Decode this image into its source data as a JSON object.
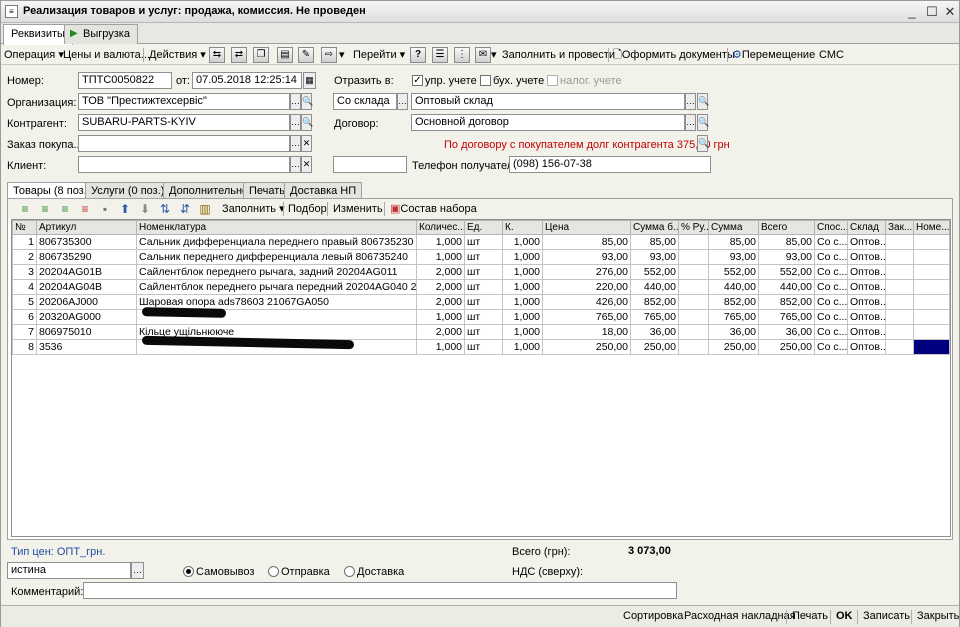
{
  "window": {
    "title": "Реализация товаров и услуг: продажа, комиссия. Не проведен"
  },
  "page_tabs": [
    {
      "label": "Реквизиты"
    },
    {
      "label": "Выгрузка"
    }
  ],
  "toolbar": {
    "operation": "Операция",
    "prices": "Цены и валюта...",
    "actions": "Действия",
    "goto": "Перейти",
    "help": "?",
    "fill_post": "Заполнить и провести",
    "make_docs": "Оформить документы",
    "move": "Перемещение",
    "sms": "СМС"
  },
  "form": {
    "number_label": "Номер:",
    "number": "ТПТС0050822",
    "date_label": "от:",
    "date": "07.05.2018 12:25:14",
    "reflect_label": "Отразить в:",
    "mgmt_label": "упр. учете",
    "acc_label": "бух. учете",
    "tax_label": "налог. учете",
    "org_label": "Организация:",
    "org": "ТОВ \"Престижтехсервіс\"",
    "warehouse_kind": "Со склада",
    "warehouse": "Оптовый склад",
    "counterparty_label": "Контрагент:",
    "counterparty": "SUBARU-PARTS-KYIV",
    "contract_label": "Договор:",
    "contract": "Основной договор",
    "order_label": "Заказ покупа...",
    "order": "",
    "debt_note": "По договору с покупателем долг контрагента 375,00 грн",
    "client_label": "Клиент:",
    "client": "",
    "extra_field": "",
    "phone_label": "Телефон получателя:",
    "phone": "(098) 156-07-38"
  },
  "inner_tabs": [
    {
      "label": "Товары (8 поз.)"
    },
    {
      "label": "Услуги (0 поз.)"
    },
    {
      "label": "Дополнительно"
    },
    {
      "label": "Печать"
    },
    {
      "label": "Доставка НП"
    }
  ],
  "table_toolbar": {
    "fill": "Заполнить",
    "pick": "Подбор",
    "change": "Изменить",
    "kit": "Состав набора"
  },
  "table": {
    "columns": [
      "№",
      "Артикул",
      "Номенклатура",
      "Количес...",
      "Ед.",
      "К.",
      "Цена",
      "Сумма б...",
      "% Ру...",
      "Сумма",
      "Всего",
      "Спос...",
      "Склад",
      "Зак...",
      "Номе..."
    ],
    "rows": [
      [
        "1",
        "806735300",
        "Сальник дифференциала переднего правый 806735230",
        "1,000",
        "шт",
        "1,000",
        "85,00",
        "85,00",
        "",
        "85,00",
        "85,00",
        "Со с...",
        "Оптов...",
        "",
        ""
      ],
      [
        "2",
        "806735290",
        "Сальник переднего дифференциала левый 806735240",
        "1,000",
        "шт",
        "1,000",
        "93,00",
        "93,00",
        "",
        "93,00",
        "93,00",
        "Со с...",
        "Оптов...",
        "",
        ""
      ],
      [
        "3",
        "20204AG01B",
        "Сайлентблок переднего рычага, задний 20204AG011",
        "2,000",
        "шт",
        "1,000",
        "276,00",
        "552,00",
        "",
        "552,00",
        "552,00",
        "Со с...",
        "Оптов...",
        "",
        ""
      ],
      [
        "4",
        "20204AG04B",
        "Сайлентблок  переднего рычага передний 20204AG040 202...",
        "2,000",
        "шт",
        "1,000",
        "220,00",
        "440,00",
        "",
        "440,00",
        "440,00",
        "Со с...",
        "Оптов...",
        "",
        ""
      ],
      [
        "5",
        "20206AJ000",
        "Шаровая опора ads78603 21067GA050",
        "2,000",
        "шт",
        "1,000",
        "426,00",
        "852,00",
        "",
        "852,00",
        "852,00",
        "Со с...",
        "Оптов...",
        "",
        ""
      ],
      [
        "6",
        "20320AG000",
        "",
        "1,000",
        "шт",
        "1,000",
        "765,00",
        "765,00",
        "",
        "765,00",
        "765,00",
        "Со с...",
        "Оптов...",
        "",
        ""
      ],
      [
        "7",
        "806975010",
        "Кільце ущільнююче",
        "2,000",
        "шт",
        "1,000",
        "18,00",
        "36,00",
        "",
        "36,00",
        "36,00",
        "Со с...",
        "Оптов...",
        "",
        ""
      ],
      [
        "8",
        "3536",
        "",
        "1,000",
        "шт",
        "1,000",
        "250,00",
        "250,00",
        "",
        "250,00",
        "250,00",
        "Со с...",
        "Оптов...",
        "",
        ""
      ]
    ]
  },
  "footer": {
    "price_type": "Тип цен: ОПТ_грн.",
    "total_label": "Всего (грн):",
    "total": "3 073,00",
    "vat_label": "НДС (сверху):",
    "value_field": "истина",
    "pickup": "Самовывоз",
    "shipping": "Отправка",
    "delivery": "Доставка",
    "comment_label": "Комментарий:",
    "comment": ""
  },
  "status_bar": {
    "sort": "Сортировка",
    "invoice": "Расходная накладная",
    "print": "Печать",
    "ok": "OK",
    "save": "Записать",
    "close": "Закрыть"
  },
  "colors": {
    "link": "#1f4f9f",
    "warning": "#c00000",
    "selection": "#00007f"
  }
}
